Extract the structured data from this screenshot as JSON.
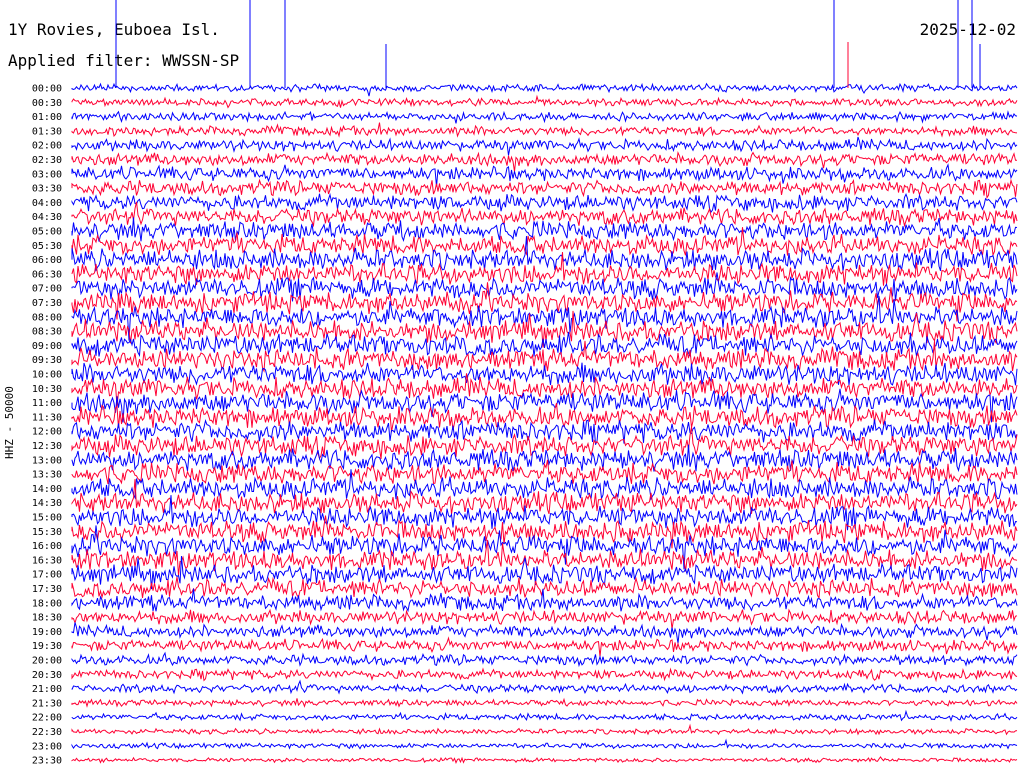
{
  "header": {
    "station": "1Y Rovies, Euboea Isl.",
    "filter": "Applied filter: WWSSN-SP",
    "date": "2025-12-02"
  },
  "colors": {
    "odd": "#0000ff",
    "even": "#ff0033"
  },
  "chart_data": {
    "type": "line",
    "title": "",
    "ylabel": "HHZ - 50000",
    "x_unit": "minutes within row",
    "row_duration_min": 30,
    "rows": [
      {
        "label": "00:00",
        "color": "#0000ff",
        "amp": 0.35
      },
      {
        "label": "00:30",
        "color": "#ff0033",
        "amp": 0.35
      },
      {
        "label": "01:00",
        "color": "#0000ff",
        "amp": 0.4
      },
      {
        "label": "01:30",
        "color": "#ff0033",
        "amp": 0.45
      },
      {
        "label": "02:00",
        "color": "#0000ff",
        "amp": 0.55
      },
      {
        "label": "02:30",
        "color": "#ff0033",
        "amp": 0.6
      },
      {
        "label": "03:00",
        "color": "#0000ff",
        "amp": 0.65
      },
      {
        "label": "03:30",
        "color": "#ff0033",
        "amp": 0.7
      },
      {
        "label": "04:00",
        "color": "#0000ff",
        "amp": 0.75
      },
      {
        "label": "04:30",
        "color": "#ff0033",
        "amp": 0.8
      },
      {
        "label": "05:00",
        "color": "#0000ff",
        "amp": 0.9
      },
      {
        "label": "05:30",
        "color": "#ff0033",
        "amp": 0.95
      },
      {
        "label": "06:00",
        "color": "#0000ff",
        "amp": 1.0
      },
      {
        "label": "06:30",
        "color": "#ff0033",
        "amp": 1.0
      },
      {
        "label": "07:00",
        "color": "#0000ff",
        "amp": 1.0
      },
      {
        "label": "07:30",
        "color": "#ff0033",
        "amp": 1.0
      },
      {
        "label": "08:00",
        "color": "#0000ff",
        "amp": 1.0
      },
      {
        "label": "08:30",
        "color": "#ff0033",
        "amp": 1.0
      },
      {
        "label": "09:00",
        "color": "#0000ff",
        "amp": 1.0
      },
      {
        "label": "09:30",
        "color": "#ff0033",
        "amp": 1.0
      },
      {
        "label": "10:00",
        "color": "#0000ff",
        "amp": 1.0
      },
      {
        "label": "10:30",
        "color": "#ff0033",
        "amp": 1.0
      },
      {
        "label": "11:00",
        "color": "#0000ff",
        "amp": 1.0
      },
      {
        "label": "11:30",
        "color": "#ff0033",
        "amp": 1.0
      },
      {
        "label": "12:00",
        "color": "#0000ff",
        "amp": 1.0
      },
      {
        "label": "12:30",
        "color": "#ff0033",
        "amp": 1.0
      },
      {
        "label": "13:00",
        "color": "#0000ff",
        "amp": 1.0
      },
      {
        "label": "13:30",
        "color": "#ff0033",
        "amp": 1.0
      },
      {
        "label": "14:00",
        "color": "#0000ff",
        "amp": 1.0
      },
      {
        "label": "14:30",
        "color": "#ff0033",
        "amp": 1.0
      },
      {
        "label": "15:00",
        "color": "#0000ff",
        "amp": 1.0
      },
      {
        "label": "15:30",
        "color": "#ff0033",
        "amp": 1.0
      },
      {
        "label": "16:00",
        "color": "#0000ff",
        "amp": 1.0
      },
      {
        "label": "16:30",
        "color": "#ff0033",
        "amp": 0.95
      },
      {
        "label": "17:00",
        "color": "#0000ff",
        "amp": 0.9
      },
      {
        "label": "17:30",
        "color": "#ff0033",
        "amp": 0.85
      },
      {
        "label": "18:00",
        "color": "#0000ff",
        "amp": 0.75
      },
      {
        "label": "18:30",
        "color": "#ff0033",
        "amp": 0.65
      },
      {
        "label": "19:00",
        "color": "#0000ff",
        "amp": 0.6
      },
      {
        "label": "19:30",
        "color": "#ff0033",
        "amp": 0.55
      },
      {
        "label": "20:00",
        "color": "#0000ff",
        "amp": 0.5
      },
      {
        "label": "20:30",
        "color": "#ff0033",
        "amp": 0.45
      },
      {
        "label": "21:00",
        "color": "#0000ff",
        "amp": 0.4
      },
      {
        "label": "21:30",
        "color": "#ff0033",
        "amp": 0.3
      },
      {
        "label": "22:00",
        "color": "#0000ff",
        "amp": 0.3
      },
      {
        "label": "22:30",
        "color": "#ff0033",
        "amp": 0.25
      },
      {
        "label": "23:00",
        "color": "#0000ff",
        "amp": 0.25
      },
      {
        "label": "23:30",
        "color": "#ff0033",
        "amp": 0.2
      }
    ],
    "grid": false,
    "legend": "none"
  }
}
